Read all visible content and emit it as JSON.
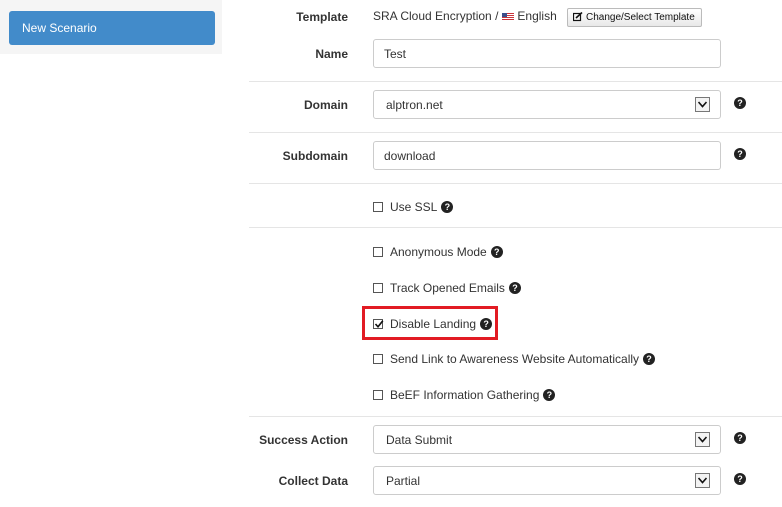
{
  "sidebar": {
    "new_scenario_label": "New Scenario"
  },
  "form": {
    "template": {
      "label": "Template",
      "value": "SRA Cloud Encryption /",
      "language": "English",
      "button_label": "Change/Select Template"
    },
    "name": {
      "label": "Name",
      "value": "Test"
    },
    "domain": {
      "label": "Domain",
      "value": "alptron.net"
    },
    "subdomain": {
      "label": "Subdomain",
      "value": "download"
    },
    "use_ssl": {
      "label": "Use SSL",
      "checked": false
    },
    "options": [
      {
        "label": "Anonymous Mode",
        "checked": false
      },
      {
        "label": "Track Opened Emails",
        "checked": false
      },
      {
        "label": "Disable Landing",
        "checked": true
      },
      {
        "label": "Send Link to Awareness Website Automatically",
        "checked": false
      },
      {
        "label": "BeEF Information Gathering",
        "checked": false
      }
    ],
    "success_action": {
      "label": "Success Action",
      "value": "Data Submit"
    },
    "collect_data": {
      "label": "Collect Data",
      "value": "Partial"
    }
  },
  "help_glyph": "?",
  "colors": {
    "primary": "#428bca",
    "highlight": "#e21b23"
  },
  "icons": {
    "help": "question-circle-icon",
    "edit": "edit-icon",
    "select_arrow": "chevron-down-icon",
    "flag": "us-flag-icon"
  }
}
